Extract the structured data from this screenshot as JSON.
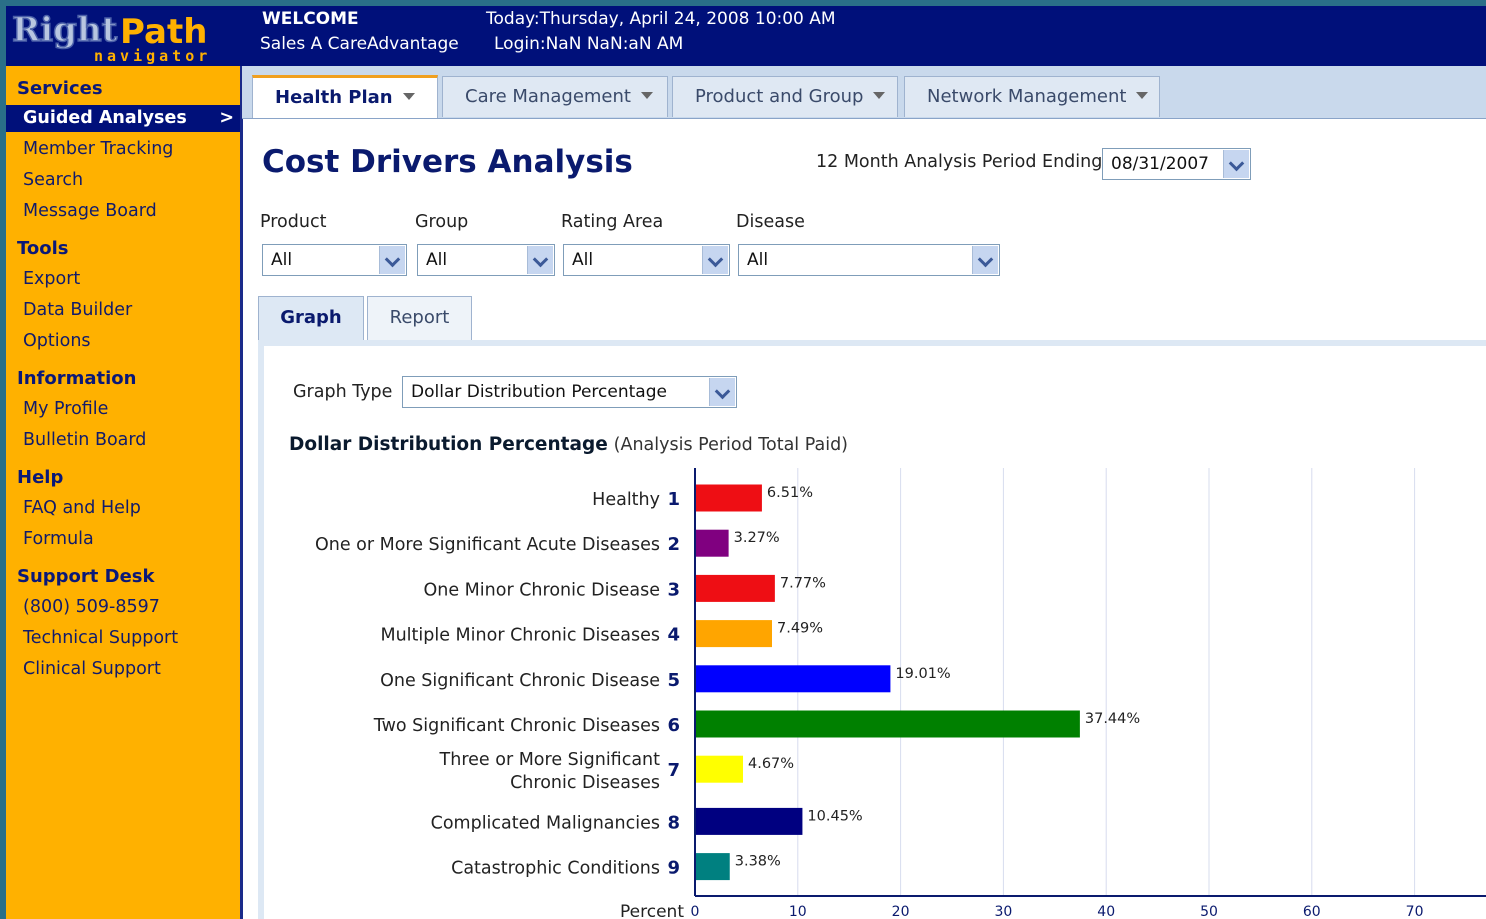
{
  "header": {
    "logo_main": "RightPath",
    "logo_sub": "navigator",
    "welcome": "WELCOME",
    "user": "Sales A CareAdvantage",
    "today": "Today:Thursday, April 24, 2008 10:00 AM",
    "login": "Login:NaN NaN:aN AM"
  },
  "sidebar": {
    "sections": [
      {
        "title": "Services",
        "items": [
          "Guided Analyses",
          "Member Tracking",
          "Search",
          "Message Board"
        ]
      },
      {
        "title": "Tools",
        "items": [
          "Export",
          "Data Builder",
          "Options"
        ]
      },
      {
        "title": "Information",
        "items": [
          "My Profile",
          "Bulletin Board"
        ]
      },
      {
        "title": "Help",
        "items": [
          "FAQ and Help",
          "Formula"
        ]
      },
      {
        "title": "Support Desk",
        "items": [
          "(800) 509-8597",
          "Technical Support",
          "Clinical Support"
        ]
      }
    ],
    "active_item": "Guided Analyses"
  },
  "main_tabs": [
    "Health Plan",
    "Care Management",
    "Product and Group",
    "Network Management"
  ],
  "active_main_tab": "Health Plan",
  "page": {
    "title": "Cost Drivers Analysis",
    "period_label": "12 Month Analysis Period Ending",
    "period_value": "08/31/2007"
  },
  "filters": [
    {
      "label": "Product",
      "value": "All"
    },
    {
      "label": "Group",
      "value": "All"
    },
    {
      "label": "Rating Area",
      "value": "All"
    },
    {
      "label": "Disease",
      "value": "All"
    }
  ],
  "sub_tabs": [
    "Graph",
    "Report"
  ],
  "active_sub_tab": "Graph",
  "graph_type": {
    "label": "Graph Type",
    "value": "Dollar Distribution Percentage"
  },
  "chart_heading": {
    "title": "Dollar Distribution Percentage",
    "subtitle": "(Analysis Period Total Paid)"
  },
  "colors": {
    "header": "#00107a",
    "sidebar": "#ffb100",
    "accent": "#0a1a6e"
  },
  "chart_data": {
    "type": "bar",
    "orientation": "horizontal",
    "xlabel": "Percent",
    "xlim": [
      0,
      77
    ],
    "xticks": [
      0,
      10,
      20,
      30,
      40,
      50,
      60,
      70
    ],
    "grid": true,
    "categories": [
      {
        "label": "Healthy",
        "num": "1"
      },
      {
        "label": "One or More Significant Acute Diseases",
        "num": "2"
      },
      {
        "label": "One Minor Chronic Disease",
        "num": "3"
      },
      {
        "label": "Multiple Minor Chronic Diseases",
        "num": "4"
      },
      {
        "label": "One Significant Chronic Disease",
        "num": "5"
      },
      {
        "label": "Two Significant Chronic Diseases",
        "num": "6"
      },
      {
        "label": "Three or More Significant Chronic Diseases",
        "num": "7"
      },
      {
        "label": "Complicated Malignancies",
        "num": "8"
      },
      {
        "label": "Catastrophic Conditions",
        "num": "9"
      }
    ],
    "values": [
      6.51,
      3.27,
      7.77,
      7.49,
      19.01,
      37.44,
      4.67,
      10.45,
      3.38
    ],
    "value_labels": [
      "6.51%",
      "3.27%",
      "7.77%",
      "7.49%",
      "19.01%",
      "37.44%",
      "4.67%",
      "10.45%",
      "3.38%"
    ],
    "bar_colors": [
      "#ee0e14",
      "#800080",
      "#ee0e14",
      "#ffa500",
      "#0000ff",
      "#008000",
      "#ffff00",
      "#000080",
      "#008080"
    ]
  }
}
